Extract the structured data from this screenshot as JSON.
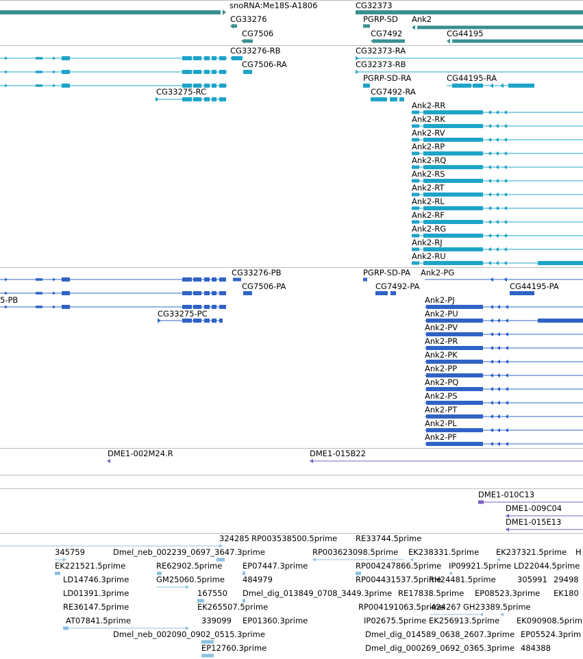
{
  "colors": {
    "genes": "#3a8f8f",
    "transcripts": "#1ea4c8",
    "proteins": "#2f63c6",
    "clones": "#7a5cc4",
    "ests": "#8cc0e0",
    "divider": "#bdbdbd"
  },
  "genes": [
    "snoRNA:Me18S-A1806",
    "CG33276",
    "CG7506",
    "CG32373",
    "PGRP-SD",
    "Ank2",
    "CG7492",
    "CG44195"
  ],
  "transcripts": [
    "CG33276-RB",
    "CG7506-RA",
    "CG32373-RA",
    "CG32373-RB",
    "PGRP-SD-RA",
    "CG44195-RA",
    "CG33275-RC",
    "CG7492-RA",
    "Ank2-RR",
    "Ank2-RK",
    "Ank2-RV",
    "Ank2-RP",
    "Ank2-RQ",
    "Ank2-RS",
    "Ank2-RT",
    "Ank2-RL",
    "Ank2-RF",
    "Ank2-RG",
    "Ank2-RJ",
    "Ank2-RU"
  ],
  "proteins": [
    "CG33276-PB",
    "PGRP-SD-PA",
    "Ank2-PG",
    "CG7506-PA",
    "CG7492-PA",
    "CG44195-PA",
    "5-PB",
    "CG33275-PC",
    "Ank2-PJ",
    "Ank2-PU",
    "Ank2-PV",
    "Ank2-PR",
    "Ank2-PK",
    "Ank2-PP",
    "Ank2-PQ",
    "Ank2-PS",
    "Ank2-PT",
    "Ank2-PL",
    "Ank2-PF"
  ],
  "clones_a": [
    "DME1-002M24.R",
    "DME1-015B22"
  ],
  "clones_b": [
    "DME1-010C13",
    "DME1-009C04",
    "DME1-015E13"
  ],
  "ests": [
    "324285",
    "RP003538500.5prime",
    "RE33744.5prime",
    "345759",
    "Dmel_neb_002239_0697_3647.3prime",
    "RP003623098.5prime",
    "EK238331.5prime",
    "EK237321.5prime",
    "H",
    "EK221521.5prime",
    "RE62902.5prime",
    "EP07447.3prime",
    "RP004247866.5prime",
    "IP09921.5prime",
    "LD22044.5prime",
    "LD14746.3prime",
    "GM25060.5prime",
    "484979",
    "RP004431537.5prime",
    "RH24481.5prime",
    "305991",
    "29498",
    "LD01391.3prime",
    "167550",
    "Dmel_dig_013849_0708_3449.3prime",
    "RE17838.5prime",
    "EP08523.3prime",
    "EK180",
    "RE36147.5prime",
    "EK265507.5prime",
    "RP004191063.5prime",
    "424267",
    "GH23389.5prime",
    "AT07841.5prime",
    "339099",
    "EP01360.3prime",
    "IP02675.5prime",
    "EK256913.5prime",
    "EK090908.5prim",
    "Dmel_neb_002090_0902_0515.3prime",
    "Dmel_dig_014589_0638_2607.3prime",
    "EP05524.3prim",
    "EP12760.3prime",
    "Dmel_dig_000269_0692_0365.3prime",
    "484388"
  ]
}
